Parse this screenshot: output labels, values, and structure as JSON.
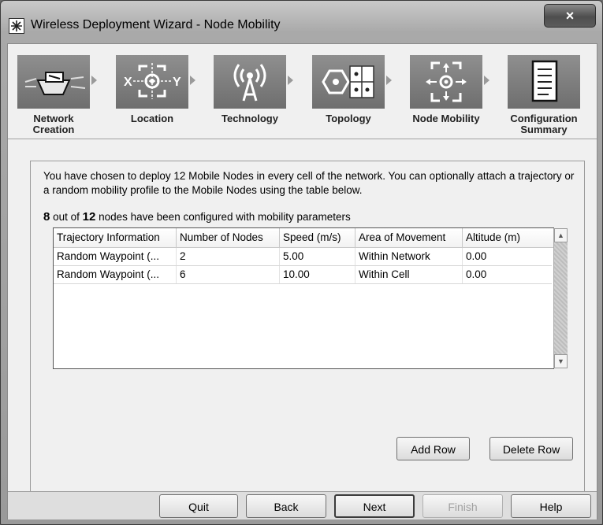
{
  "window": {
    "title": "Wireless Deployment Wizard - Node Mobility",
    "close_label": "×"
  },
  "steps": [
    {
      "label": "Network Creation",
      "icon": "network-creation-icon"
    },
    {
      "label": "Location",
      "icon": "location-crosshair-icon"
    },
    {
      "label": "Technology",
      "icon": "antenna-tower-icon"
    },
    {
      "label": "Topology",
      "icon": "topology-tiles-icon"
    },
    {
      "label": "Node Mobility",
      "icon": "node-mobility-icon"
    },
    {
      "label": "Configuration Summary",
      "icon": "document-icon"
    }
  ],
  "intro": "You have chosen to deploy 12 Mobile Nodes in every cell of the network. You can optionally attach a trajectory or a random mobility profile to the Mobile Nodes using the table below.",
  "count": {
    "configured": "8",
    "mid": "out of",
    "total": "12",
    "suffix": "nodes have been configured with mobility parameters"
  },
  "table": {
    "headers": [
      "Trajectory Information",
      "Number of Nodes",
      "Speed (m/s)",
      "Area of Movement",
      "Altitude (m)"
    ],
    "rows": [
      [
        "Random Waypoint (...",
        "2",
        "5.00",
        "Within Network",
        "0.00"
      ],
      [
        "Random Waypoint (...",
        "6",
        "10.00",
        "Within Cell",
        "0.00"
      ]
    ]
  },
  "buttons": {
    "add_row": "Add Row",
    "delete_row": "Delete Row",
    "quit": "Quit",
    "back": "Back",
    "next": "Next",
    "finish": "Finish",
    "help": "Help"
  }
}
